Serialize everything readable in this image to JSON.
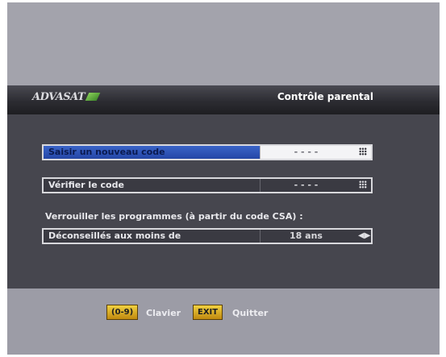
{
  "header": {
    "logo_text": "ADVASAT",
    "title": "Contrôle parental"
  },
  "rows": [
    {
      "label": "Saisir un nouveau code",
      "value": "- - - -",
      "icon": "keypad-icon",
      "selected": true
    },
    {
      "label": "Vérifier le code",
      "value": "- - - -",
      "icon": "keypad-icon",
      "selected": false
    }
  ],
  "section_heading": "Verrouiller les programmes (à partir du code CSA) :",
  "age_row": {
    "label": "Déconseillés aux moins de",
    "value": "18 ans",
    "icon": "left-right-arrows-icon"
  },
  "footer": {
    "keys": [
      {
        "key": "(0-9)",
        "label": "Clavier"
      },
      {
        "key": "EXIT",
        "label": "Quitter"
      }
    ]
  },
  "colors": {
    "selected_row": "#2f55b8",
    "panel": "#46464e",
    "key_button": "#e0b020"
  }
}
